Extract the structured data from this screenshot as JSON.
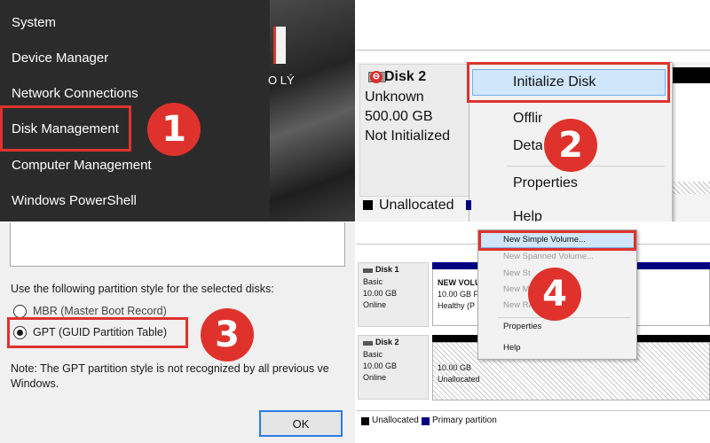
{
  "colors": {
    "accent_red": "#e0322c",
    "highlight_blue": "#cfe6fb",
    "primary_partition": "#000080"
  },
  "step1": {
    "menu_items": [
      "System",
      "Device Manager",
      "Network Connections",
      "Disk Management",
      "Computer Management",
      "Windows PowerShell"
    ],
    "desktop_label": "O LÝ",
    "badge": "1"
  },
  "step2": {
    "disk_name": "Disk 2",
    "disk_type": "Unknown",
    "disk_size": "500.00 GB",
    "disk_status": "Not Initialized",
    "menu_items": [
      "Initialize Disk",
      "Offline",
      "Details",
      "Properties",
      "Help"
    ],
    "legend_unallocated": "Unallocated",
    "badge": "2"
  },
  "step3": {
    "instruction": "Use the following partition style for the selected disks:",
    "option_mbr": "MBR (Master Boot Record)",
    "option_gpt": "GPT (GUID Partition Table)",
    "selected_option": "GPT (GUID Partition Table)",
    "note_line1": "Note: The GPT partition style is not recognized by all previous ve",
    "note_line2": "Windows.",
    "ok_label": "OK",
    "badge": "3"
  },
  "step4": {
    "disk1": {
      "name": "Disk 1",
      "type": "Basic",
      "size": "10.00 GB",
      "status": "Online"
    },
    "disk1_volume": {
      "name": "NEW VOLU",
      "size": "10.00 GB F",
      "health": "Healthy (P"
    },
    "disk2": {
      "name": "Disk 2",
      "type": "Basic",
      "size": "10.00 GB",
      "status": "Online"
    },
    "disk2_area": {
      "size": "10.00 GB",
      "state": "Unallocated"
    },
    "menu_items": [
      {
        "label": "New Simple Volume...",
        "enabled": true
      },
      {
        "label": "New Spanned Volume...",
        "enabled": false
      },
      {
        "label": "New St",
        "enabled": false
      },
      {
        "label": "New M",
        "enabled": false
      },
      {
        "label": "New RA",
        "enabled": false
      },
      {
        "label": "Properties",
        "enabled": true
      },
      {
        "label": "Help",
        "enabled": true
      }
    ],
    "legend_unallocated": "Unallocated",
    "legend_primary": "Primary partition",
    "badge": "4"
  }
}
